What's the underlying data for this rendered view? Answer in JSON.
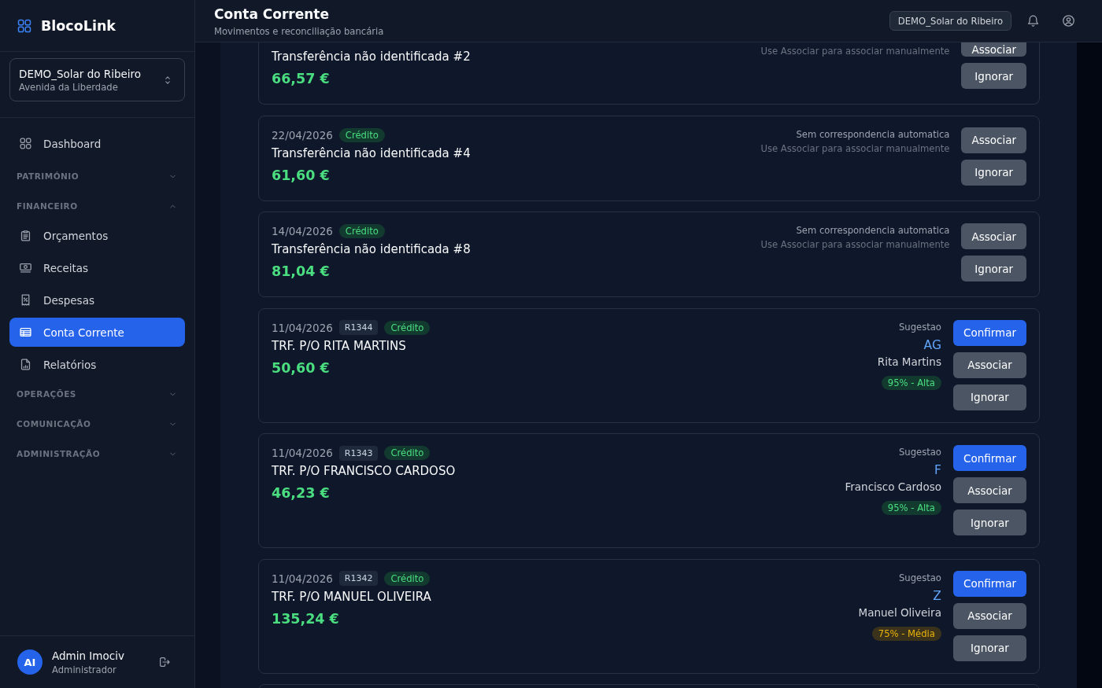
{
  "sidebar": {
    "brand": "BlocoLink",
    "property_selector": {
      "name": "DEMO_Solar do Ribeiro",
      "address": "Avenida da Liberdade"
    },
    "nav": [
      {
        "kind": "item",
        "label": "Dashboard",
        "selected": false
      },
      {
        "kind": "section",
        "label": "PATRIMÓNIO",
        "expanded": false
      },
      {
        "kind": "section",
        "label": "FINANCEIRO",
        "expanded": true,
        "children": [
          {
            "label": "Orçamentos",
            "selected": false
          },
          {
            "label": "Receitas",
            "selected": false
          },
          {
            "label": "Despesas",
            "selected": false
          },
          {
            "label": "Conta Corrente",
            "selected": true
          },
          {
            "label": "Relatórios",
            "selected": false
          }
        ]
      },
      {
        "kind": "section",
        "label": "OPERAÇÕES",
        "expanded": false
      },
      {
        "kind": "section",
        "label": "COMUNICAÇÃO",
        "expanded": false
      },
      {
        "kind": "section",
        "label": "ADMINISTRAÇÃO",
        "expanded": false
      }
    ],
    "user": {
      "initials": "AI",
      "name": "Admin Imociv",
      "role": "Administrador"
    }
  },
  "header": {
    "title": "Conta Corrente",
    "subtitle": "Movimentos e reconciliação bancária",
    "property_tag": "DEMO_Solar do Ribeiro"
  },
  "transactions": [
    {
      "kind": "no_match",
      "cut_top": true,
      "description": "Transferência não identificada #2",
      "amount": "66,57 €",
      "hint": "Use Associar para associar manualmente",
      "actions": [
        {
          "kind": "associate",
          "label": "Associar"
        },
        {
          "kind": "ignore",
          "label": "Ignorar"
        }
      ]
    },
    {
      "kind": "no_match",
      "cut_top": false,
      "date": "22/04/2026",
      "type": "Crédito",
      "description": "Transferência não identificada #4",
      "amount": "61,60 €",
      "status": "Sem correspondencia automatica",
      "hint": "Use Associar para associar manualmente",
      "actions": [
        {
          "kind": "associate",
          "label": "Associar"
        },
        {
          "kind": "ignore",
          "label": "Ignorar"
        }
      ]
    },
    {
      "kind": "no_match",
      "cut_top": false,
      "date": "14/04/2026",
      "type": "Crédito",
      "description": "Transferência não identificada #8",
      "amount": "81,04 €",
      "status": "Sem correspondencia automatica",
      "hint": "Use Associar para associar manualmente",
      "actions": [
        {
          "kind": "associate",
          "label": "Associar"
        },
        {
          "kind": "ignore",
          "label": "Ignorar"
        }
      ]
    },
    {
      "kind": "suggestion",
      "cut_top": false,
      "date": "11/04/2026",
      "reference": "R1344",
      "type": "Crédito",
      "description": "TRF. P/O RITA MARTINS",
      "amount": "50,60 €",
      "suggestion": {
        "label": "Sugestao",
        "code": "AG",
        "name": "Rita Martins",
        "confidence": {
          "text": "95% - Alta",
          "kind": "high"
        }
      },
      "actions": [
        {
          "kind": "confirm",
          "label": "Confirmar"
        },
        {
          "kind": "associate",
          "label": "Associar"
        },
        {
          "kind": "ignore",
          "label": "Ignorar"
        }
      ]
    },
    {
      "kind": "suggestion",
      "cut_top": false,
      "date": "11/04/2026",
      "reference": "R1343",
      "type": "Crédito",
      "description": "TRF. P/O FRANCISCO CARDOSO",
      "amount": "46,23 €",
      "suggestion": {
        "label": "Sugestao",
        "code": "F",
        "name": "Francisco Cardoso",
        "confidence": {
          "text": "95% - Alta",
          "kind": "high"
        }
      },
      "actions": [
        {
          "kind": "confirm",
          "label": "Confirmar"
        },
        {
          "kind": "associate",
          "label": "Associar"
        },
        {
          "kind": "ignore",
          "label": "Ignorar"
        }
      ]
    },
    {
      "kind": "suggestion",
      "cut_top": false,
      "date": "11/04/2026",
      "reference": "R1342",
      "type": "Crédito",
      "description": "TRF. P/O MANUEL OLIVEIRA",
      "amount": "135,24 €",
      "suggestion": {
        "label": "Sugestao",
        "code": "Z",
        "name": "Manuel Oliveira",
        "confidence": {
          "text": "75% - Média",
          "kind": "medium"
        }
      },
      "actions": [
        {
          "kind": "confirm",
          "label": "Confirmar"
        },
        {
          "kind": "associate",
          "label": "Associar"
        },
        {
          "kind": "ignore",
          "label": "Ignorar"
        }
      ]
    }
  ]
}
